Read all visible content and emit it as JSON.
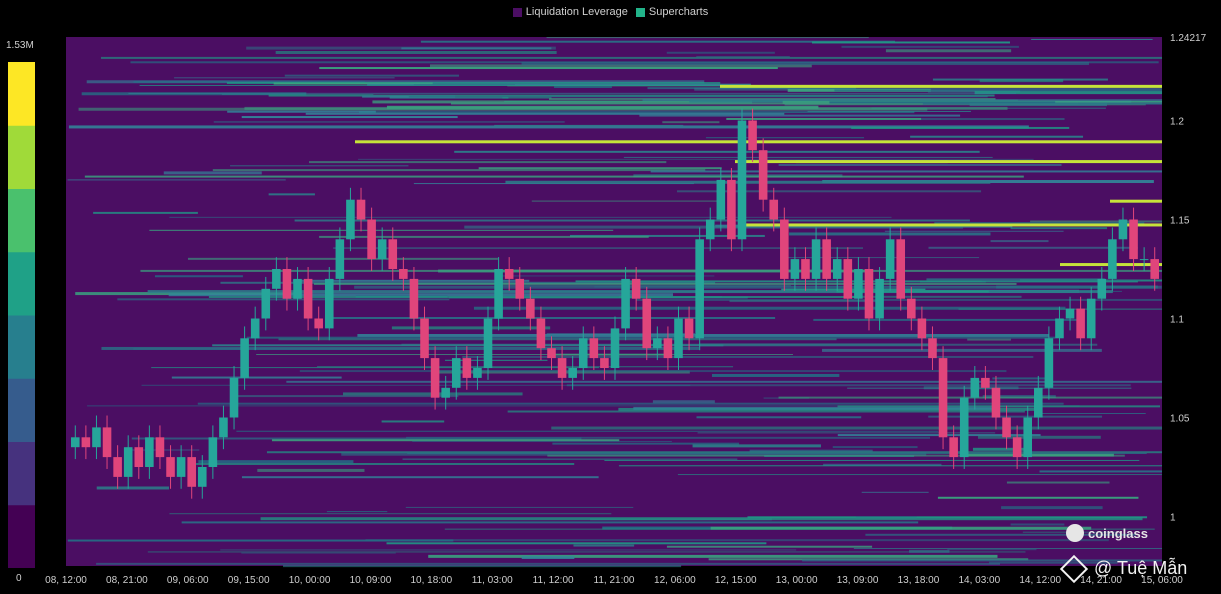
{
  "legend": {
    "items": [
      {
        "label": "Liquidation Leverage",
        "color": "#4b0e63"
      },
      {
        "label": "Supercharts",
        "color": "#22b48a"
      }
    ]
  },
  "colorbar": {
    "max_label": "1.53M",
    "min_label": "0",
    "colors": [
      "#440154",
      "#46327e",
      "#365c8d",
      "#277f8e",
      "#1fa187",
      "#4ac16d",
      "#a0da39",
      "#fde725"
    ]
  },
  "watermark": "coinglass",
  "credit": "@ Tuệ Mẫn",
  "chart_data": {
    "type": "heatmap",
    "title": "",
    "y_axis_side": "right",
    "ylim": [
      0.975,
      1.24217
    ],
    "y_ticks": [
      {
        "value": 1.24217,
        "label": "1.24217"
      },
      {
        "value": 1.2,
        "label": "1.2"
      },
      {
        "value": 1.15,
        "label": "1.15"
      },
      {
        "value": 1.1,
        "label": "1.1"
      },
      {
        "value": 1.05,
        "label": "1.05"
      },
      {
        "value": 1.0,
        "label": "1"
      }
    ],
    "x_ticks": [
      "08, 12:00",
      "08, 21:00",
      "09, 06:00",
      "09, 15:00",
      "10, 00:00",
      "10, 09:00",
      "10, 18:00",
      "11, 03:00",
      "11, 12:00",
      "11, 21:00",
      "12, 06:00",
      "12, 15:00",
      "13, 00:00",
      "13, 09:00",
      "13, 18:00",
      "14, 03:00",
      "14, 12:00",
      "14, 21:00",
      "15, 06:00"
    ],
    "background_color": "#4b0e63",
    "price_series_colors": {
      "up": "#26a69a",
      "down": "#e0457b"
    },
    "price_close": [
      1.04,
      1.035,
      1.045,
      1.03,
      1.02,
      1.035,
      1.025,
      1.04,
      1.03,
      1.02,
      1.03,
      1.015,
      1.025,
      1.04,
      1.05,
      1.07,
      1.09,
      1.1,
      1.115,
      1.125,
      1.11,
      1.12,
      1.1,
      1.095,
      1.12,
      1.14,
      1.16,
      1.15,
      1.13,
      1.14,
      1.125,
      1.12,
      1.1,
      1.08,
      1.06,
      1.065,
      1.08,
      1.07,
      1.075,
      1.1,
      1.125,
      1.12,
      1.11,
      1.1,
      1.085,
      1.08,
      1.07,
      1.075,
      1.09,
      1.08,
      1.075,
      1.095,
      1.12,
      1.11,
      1.085,
      1.09,
      1.08,
      1.1,
      1.09,
      1.14,
      1.15,
      1.17,
      1.14,
      1.2,
      1.185,
      1.16,
      1.15,
      1.12,
      1.13,
      1.12,
      1.14,
      1.12,
      1.13,
      1.11,
      1.125,
      1.1,
      1.12,
      1.14,
      1.11,
      1.1,
      1.09,
      1.08,
      1.04,
      1.03,
      1.06,
      1.07,
      1.065,
      1.05,
      1.04,
      1.03,
      1.05,
      1.065,
      1.09,
      1.1,
      1.105,
      1.09,
      1.11,
      1.12,
      1.14,
      1.15,
      1.13,
      1.13,
      1.12
    ]
  }
}
